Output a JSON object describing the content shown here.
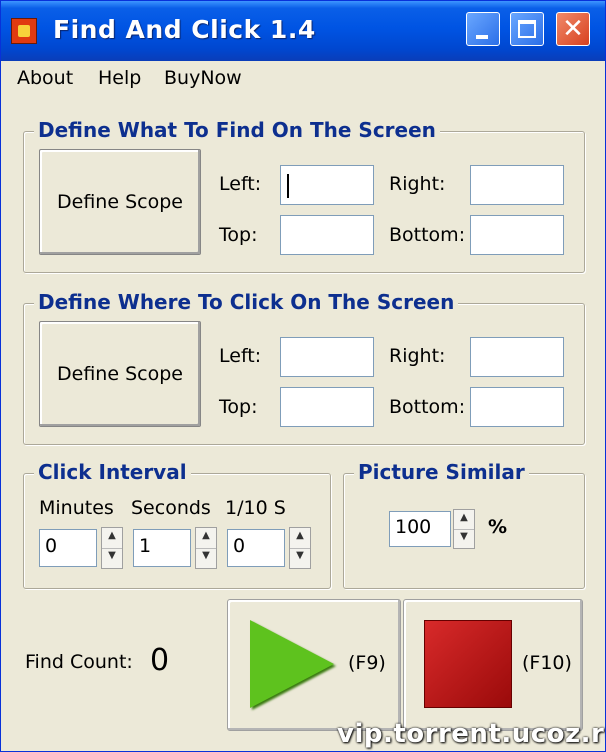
{
  "window": {
    "title": "Find And Click 1.4",
    "controls": {
      "minimize": "_",
      "maximize": "□",
      "close": "✕"
    }
  },
  "menu": {
    "about": "About",
    "help": "Help",
    "buynow": "BuyNow"
  },
  "find_section": {
    "title": "Define What To Find On The Screen",
    "define_scope": "Define Scope",
    "left_label": "Left:",
    "left_value": "",
    "right_label": "Right:",
    "right_value": "",
    "top_label": "Top:",
    "top_value": "",
    "bottom_label": "Bottom:",
    "bottom_value": ""
  },
  "click_section": {
    "title": "Define Where To Click On The Screen",
    "define_scope": "Define Scope",
    "left_label": "Left:",
    "left_value": "",
    "right_label": "Right:",
    "right_value": "",
    "top_label": "Top:",
    "top_value": "",
    "bottom_label": "Bottom:",
    "bottom_value": ""
  },
  "interval": {
    "title": "Click Interval",
    "minutes_label": "Minutes",
    "seconds_label": "Seconds",
    "tenths_label": "1/10 S",
    "minutes_value": "0",
    "seconds_value": "1",
    "tenths_value": "0"
  },
  "similar": {
    "title": "Picture Similar",
    "value": "100",
    "unit": "%"
  },
  "status": {
    "find_count_label": "Find Count:",
    "find_count_value": "0"
  },
  "actions": {
    "start_key": "(F9)",
    "stop_key": "(F10)"
  },
  "colors": {
    "title_blue": "#0054e3",
    "group_title": "#0d2f8f",
    "play_green": "#5ec21e",
    "stop_red": "#c41414"
  },
  "watermark": "vip.torrent.ucoz.ru"
}
